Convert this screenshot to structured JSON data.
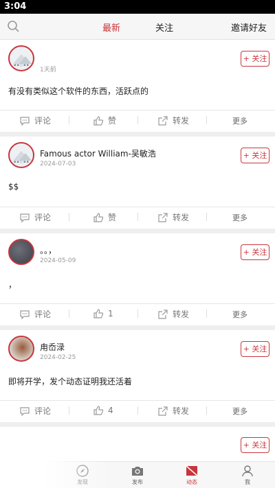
{
  "status": {
    "time": "3:04"
  },
  "header": {
    "search_icon": "search-icon",
    "tabs": [
      {
        "label": "最新",
        "active": true
      },
      {
        "label": "关注",
        "active": false
      }
    ],
    "invite": "邀请好友"
  },
  "posts": [
    {
      "name": "",
      "date": "1天前",
      "follow": "+ 关注",
      "content": "有没有类似这个软件的东西，活跃点的",
      "comment": "评论",
      "like": "赞",
      "share": "转发",
      "more": "更多"
    },
    {
      "name": "Famous actor William-吴敏浩",
      "date": "2024-07-03",
      "follow": "+ 关注",
      "content": "$$",
      "comment": "评论",
      "like": "赞",
      "share": "转发",
      "more": "更多"
    },
    {
      "name": "。。，",
      "date": "2024-05-09",
      "follow": "+ 关注",
      "content": "，",
      "comment": "评论",
      "like": "1",
      "share": "转发",
      "more": "更多"
    },
    {
      "name": "甪岙渌",
      "date": "2024-02-25",
      "follow": "+ 关注",
      "content": "即将开学，发个动态证明我还活着",
      "comment": "评论",
      "like": "4",
      "share": "转发",
      "more": "更多"
    },
    {
      "follow": "+ 关注"
    }
  ],
  "nav": [
    {
      "label": "发现",
      "icon": "compass-icon"
    },
    {
      "label": "发布",
      "icon": "camera-icon"
    },
    {
      "label": "动态",
      "icon": "feed-icon",
      "active": true
    },
    {
      "label": "我",
      "icon": "user-icon"
    }
  ],
  "colors": {
    "accent": "#c8353b",
    "background": "#efefef"
  }
}
